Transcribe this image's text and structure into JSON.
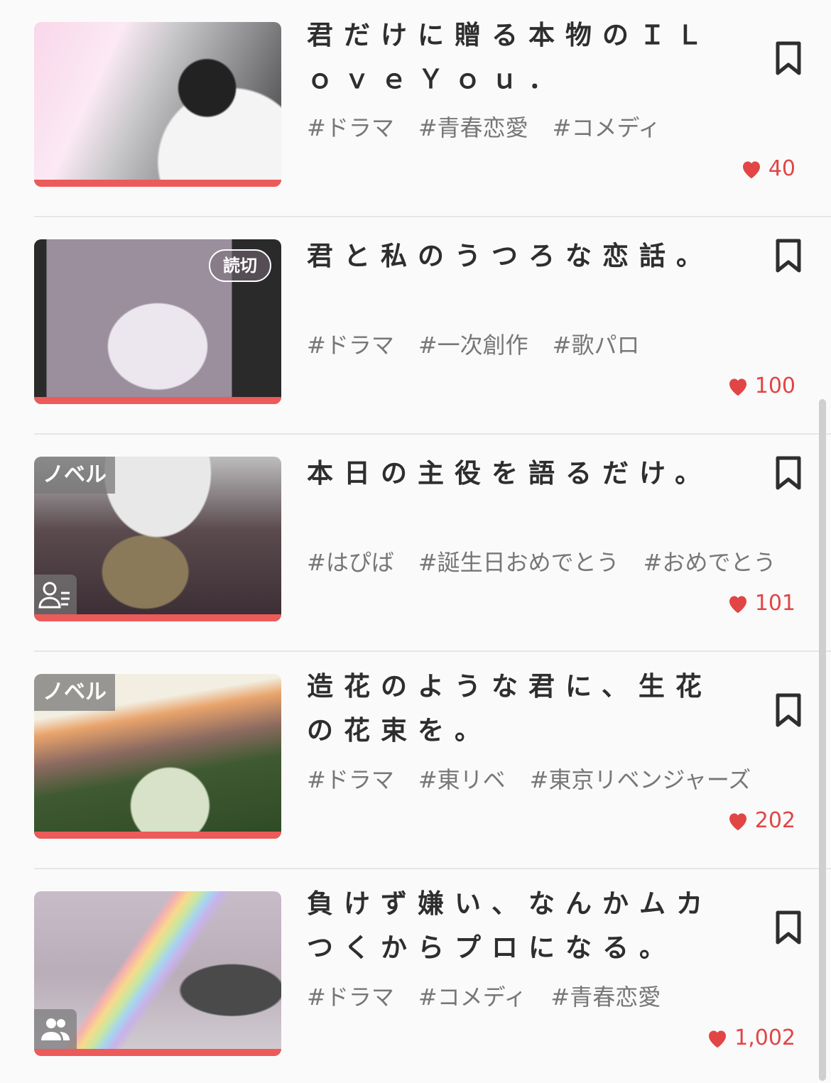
{
  "colors": {
    "accent": "#ec5a5a",
    "like": "#e24545",
    "tag": "#777777"
  },
  "items": [
    {
      "title": "君だけに贈る本物のＩＬｏｖｅＹｏｕ．",
      "tags": [
        "#ドラマ",
        "#青春恋愛",
        "#コメディ"
      ],
      "likes": "40",
      "badge": "",
      "icon": ""
    },
    {
      "title": "君と私のうつろな恋話。",
      "tags": [
        "#ドラマ",
        "#一次創作",
        "#歌パロ"
      ],
      "likes": "100",
      "badge": "読切",
      "icon": ""
    },
    {
      "title": "本日の主役を語るだけ。",
      "tags": [
        "#はぴば",
        "#誕生日おめでとう",
        "#おめでとう"
      ],
      "likes": "101",
      "badge": "ノベル",
      "icon": "person-list-icon"
    },
    {
      "title": "造花のような君に、生花の花束を。",
      "tags": [
        "#ドラマ",
        "#東リベ",
        "#東京リベンジャーズ"
      ],
      "likes": "202",
      "badge": "ノベル",
      "icon": ""
    },
    {
      "title": "負けず嫌い、なんかムカつくからプロになる。",
      "tags": [
        "#ドラマ",
        "#コメディ",
        "#青春恋愛"
      ],
      "likes": "1,002",
      "badge": "",
      "icon": "group-icon"
    }
  ]
}
